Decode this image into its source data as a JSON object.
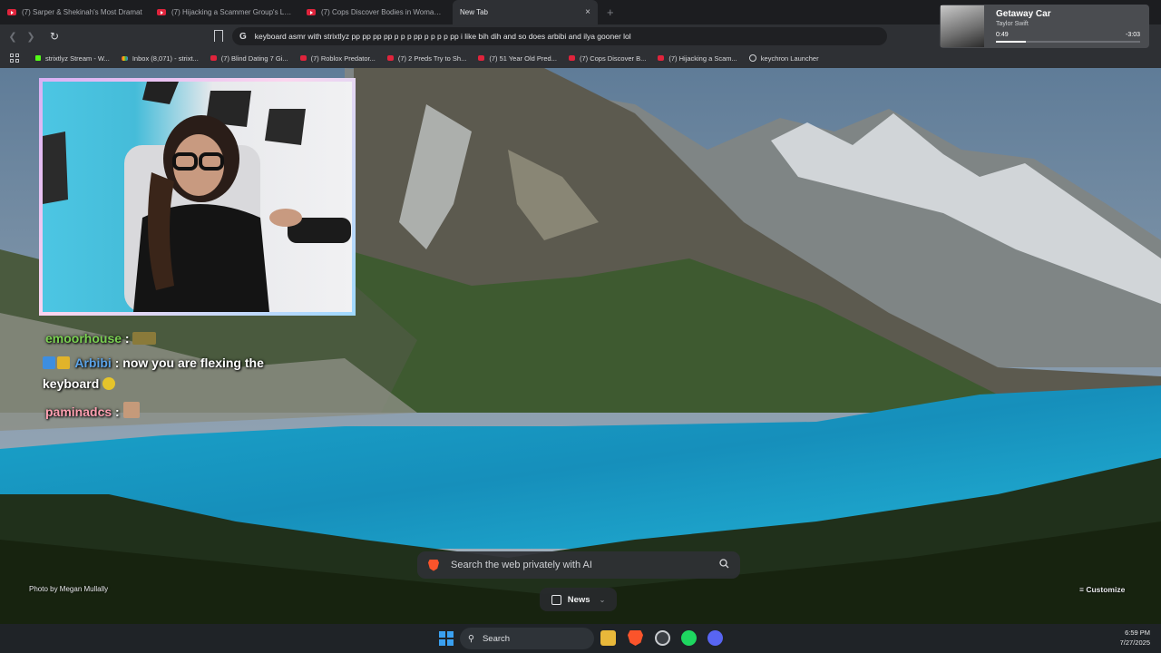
{
  "browser": {
    "tabs": [
      {
        "label": "(7) Sarper & Shekinah's Most Dramat",
        "type": "youtube"
      },
      {
        "label": "(7) Hijacking a Scammer Group's Live",
        "type": "youtube"
      },
      {
        "label": "(7) Cops Discover Bodies in Woman's",
        "type": "youtube"
      }
    ],
    "active_tab": {
      "label": "New Tab",
      "close": "×"
    },
    "new_tab_symbol": "+",
    "omnibox": {
      "engine_glyph": "G",
      "query": "keyboard asmr with strixtlyz pp pp pp pp p p p pp p p p p pp i like bih dih and so does arbibi and ilya gooner lol"
    },
    "bookmarks": [
      {
        "label": "strixtlyz Stream - W...",
        "icon": "kick"
      },
      {
        "label": "Inbox (8,071) - strixt...",
        "icon": "gmail"
      },
      {
        "label": "(7) Blind Dating 7 Gi...",
        "icon": "youtube"
      },
      {
        "label": "(7) Roblox Predator...",
        "icon": "youtube"
      },
      {
        "label": "(7) 2 Preds Try to Sh...",
        "icon": "youtube"
      },
      {
        "label": "(7) 51 Year Old Pred...",
        "icon": "youtube"
      },
      {
        "label": "(7) Cops Discover B...",
        "icon": "youtube"
      },
      {
        "label": "(7) Hijacking a Scam...",
        "icon": "youtube"
      },
      {
        "label": "keychron Launcher",
        "icon": "keychron"
      }
    ]
  },
  "now_playing": {
    "title": "Getaway Car",
    "artist": "Taylor Swift",
    "elapsed": "0:49",
    "remaining": "-3:03",
    "progress_fraction": 0.21
  },
  "chat": [
    {
      "user": "emoorhouse",
      "sep": " :",
      "text": ""
    },
    {
      "user": "Arbibi",
      "sep": " :",
      "text": " now you are flexing the"
    },
    {
      "user": "",
      "sep": "",
      "text": "keyboard"
    },
    {
      "user": "paminadcs",
      "sep": " :",
      "text": ""
    }
  ],
  "newtab": {
    "photo_credit": "Photo by Megan Mullally",
    "search_placeholder": "Search the web privately with AI",
    "news_label": "News",
    "customize_label": "Customize"
  },
  "taskbar": {
    "search_label": "Search",
    "time": "6:59 PM",
    "date": "7/27/2025"
  },
  "colors": {
    "brave_orange": "#fb542b",
    "youtube_red": "#e0243c",
    "spotify_green": "#1ed760",
    "chat_green": "#7ad152",
    "chat_blue": "#5ba3e8"
  }
}
